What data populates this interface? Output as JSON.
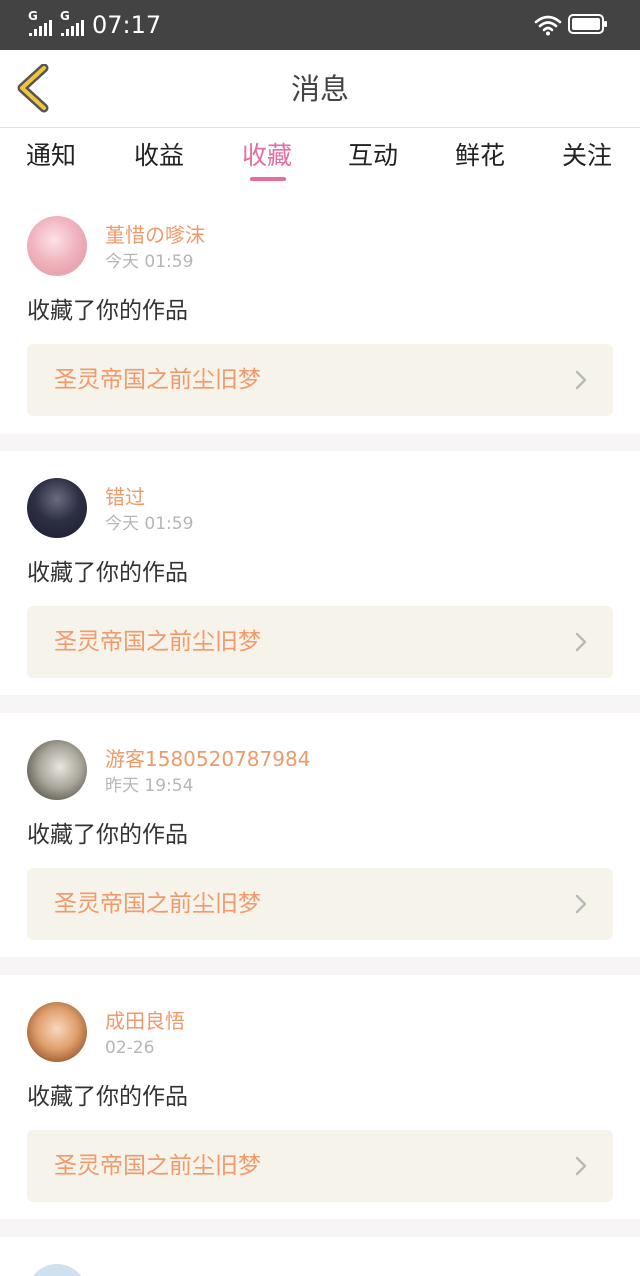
{
  "status_bar": {
    "signal1_label": "G",
    "signal2_label": "G",
    "time": "07:17"
  },
  "header": {
    "title": "消息"
  },
  "tabs": [
    {
      "label": "通知"
    },
    {
      "label": "收益"
    },
    {
      "label": "收藏",
      "active": true
    },
    {
      "label": "互动"
    },
    {
      "label": "鲜花"
    },
    {
      "label": "关注"
    }
  ],
  "messages": [
    {
      "user": "堇惜の嗲沫",
      "time": "今天 01:59",
      "action": "收藏了你的作品",
      "work": "圣灵帝国之前尘旧梦"
    },
    {
      "user": "错过",
      "time": "今天 01:59",
      "action": "收藏了你的作品",
      "work": "圣灵帝国之前尘旧梦"
    },
    {
      "user": "游客1580520787984",
      "time": "昨天 19:54",
      "action": "收藏了你的作品",
      "work": "圣灵帝国之前尘旧梦"
    },
    {
      "user": "成田良悟",
      "time": "02-26",
      "action": "收藏了你的作品",
      "work": "圣灵帝国之前尘旧梦"
    }
  ],
  "colors": {
    "accent": "#e46ea1",
    "username": "#f09a6a",
    "work_bg": "#f5f3ea"
  }
}
